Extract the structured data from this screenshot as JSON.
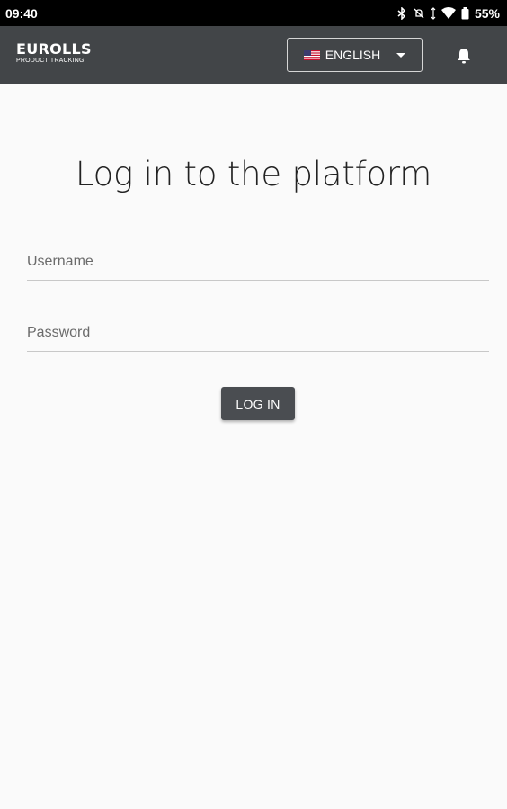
{
  "status_bar": {
    "time": "09:40",
    "battery": "55%"
  },
  "app_bar": {
    "logo_main": "EUROLLS",
    "logo_sub": "PRODUCT TRACKING",
    "language_label": "ENGLISH",
    "language_flag": "us-flag-icon",
    "notification_icon": "bell-icon"
  },
  "login": {
    "title": "Log in to the platform",
    "username_placeholder": "Username",
    "password_placeholder": "Password",
    "submit_label": "LOG IN"
  },
  "colors": {
    "status_bar": "#000000",
    "app_bar": "#424548",
    "background": "#fafafa",
    "button": "#4a4d51"
  }
}
